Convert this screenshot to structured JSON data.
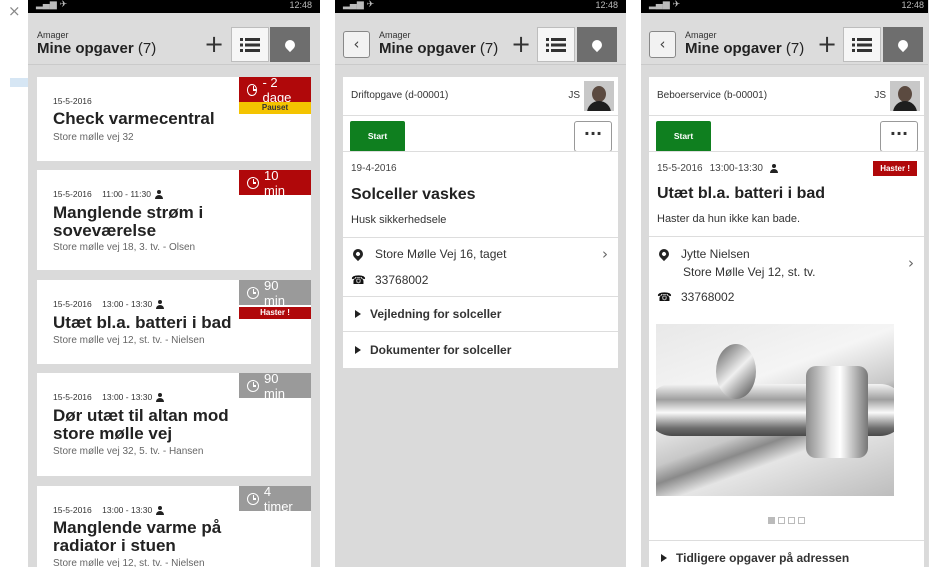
{
  "status": {
    "right": "12:48"
  },
  "screen1": {
    "header": {
      "sub": "Amager",
      "title": "Mine opgaver",
      "count": "(7)",
      "add": "+"
    },
    "tasks": [
      {
        "date": "15-5-2016",
        "time": "",
        "title": "Check varmecentral",
        "address": "Store mølle vej 32",
        "badge": "- 2 dage",
        "badge_color": "red",
        "tag": "Pauset"
      },
      {
        "date": "15-5-2016",
        "time": "11:00 - 11:30",
        "title": "Manglende strøm i soveværelse",
        "address": "Store mølle vej 18, 3. tv. - Olsen",
        "badge": "10 min",
        "badge_color": "red",
        "tag": ""
      },
      {
        "date": "15-5-2016",
        "time": "13:00 - 13:30",
        "title": "Utæt bl.a. batteri i bad",
        "address": "Store mølle vej 12, st. tv. - Nielsen",
        "badge": "90 min",
        "badge_color": "grey",
        "tag": "Haster !"
      },
      {
        "date": "15-5-2016",
        "time": "13:00 - 13:30",
        "title": "Dør utæt til altan mod store mølle vej",
        "address": "Store mølle vej 32, 5. tv. - Hansen",
        "badge": "90 min",
        "badge_color": "grey",
        "tag": ""
      },
      {
        "date": "15-5-2016",
        "time": "13:00 - 13:30",
        "title": "Manglende varme på radiator i stuen",
        "address": "Store mølle vej 12, st. tv. - Nielsen",
        "badge": "4 timer",
        "badge_color": "grey",
        "tag": ""
      }
    ]
  },
  "screen2": {
    "header": {
      "sub": "Amager",
      "title": "Mine opgaver",
      "count": "(7)",
      "add": "+"
    },
    "type": "Driftopgave (d-00001)",
    "initials": "JS",
    "start": "Start",
    "more": "···",
    "date": "19-4-2016",
    "title": "Solceller vaskes",
    "note": "Husk sikkerhedsele",
    "address": "Store Mølle Vej 16, taget",
    "phone": "33768002",
    "sections": [
      "Vejledning for solceller",
      "Dokumenter for solceller"
    ]
  },
  "screen3": {
    "header": {
      "sub": "Amager",
      "title": "Mine opgaver",
      "count": "(7)",
      "add": "+"
    },
    "type": "Beboerservice (b-00001)",
    "initials": "JS",
    "start": "Start",
    "more": "···",
    "date": "15-5-2016",
    "time": "13:00-13:30",
    "tag": "Haster !",
    "title": "Utæt bl.a. batteri i bad",
    "note": "Haster da hun ikke kan bade.",
    "resident": "Jytte Nielsen",
    "address": "Store Mølle Vej 12, st. tv.",
    "phone": "33768002",
    "section": "Tidligere opgaver på adressen"
  }
}
